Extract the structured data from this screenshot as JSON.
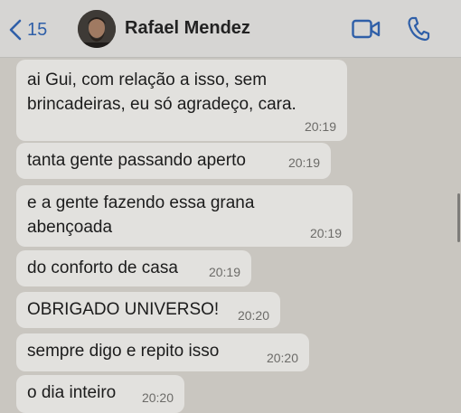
{
  "header": {
    "back_count": "15",
    "contact_name": "Rafael Mendez"
  },
  "messages": [
    {
      "text": "ai Gui, com relação a isso, sem\nbrincadeiras, eu só agradeço, cara.",
      "time": "20:19"
    },
    {
      "text": "tanta gente passando aperto",
      "time": "20:19"
    },
    {
      "text": "e a gente fazendo essa grana\nabençoada",
      "time": "20:19"
    },
    {
      "text": "do conforto de casa",
      "time": "20:19"
    },
    {
      "text": "OBRIGADO UNIVERSO!",
      "time": "20:20"
    },
    {
      "text": "sempre digo e repito isso",
      "time": "20:20"
    },
    {
      "text": "o dia inteiro",
      "time": "20:20"
    }
  ],
  "colors": {
    "accent": "#2f5fa8",
    "bubble": "#e2e1de",
    "background": "#c9c6c0"
  },
  "icons": [
    "chevron-left-icon",
    "video-camera-icon",
    "phone-icon"
  ]
}
